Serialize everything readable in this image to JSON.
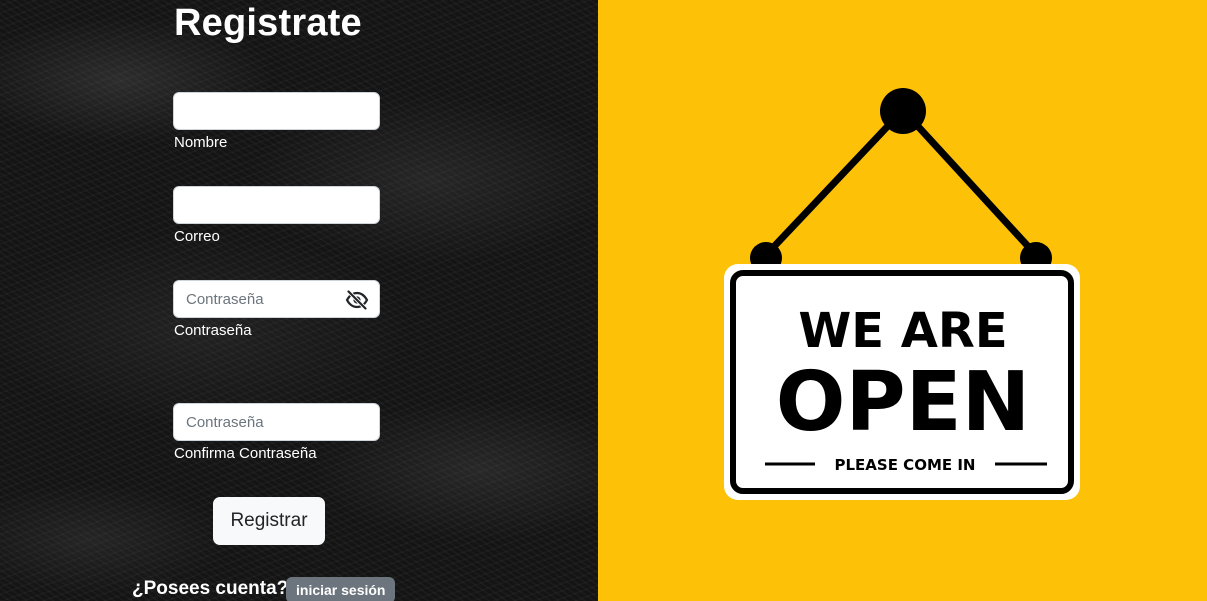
{
  "form": {
    "title": "Registrate",
    "fields": {
      "name": {
        "value": "",
        "placeholder": "",
        "label": "Nombre"
      },
      "email": {
        "value": "",
        "placeholder": "",
        "label": "Correo"
      },
      "password": {
        "value": "",
        "placeholder": "Contraseña",
        "label": "Contraseña"
      },
      "confirm_password": {
        "value": "",
        "placeholder": "Contraseña",
        "label": "Confirma Contraseña"
      }
    },
    "submit_label": "Registrar"
  },
  "footer": {
    "question": "¿Posees cuenta?",
    "login_label": "iniciar sesión"
  },
  "icons": {
    "password_toggle": "eye-slash-icon"
  },
  "sign": {
    "line1": "WE ARE",
    "line2": "OPEN",
    "line3": "PLEASE COME IN"
  },
  "colors": {
    "right_panel_bg": "#fdc107",
    "badge_bg": "#6c757d",
    "button_bg": "#f8f9fa"
  }
}
